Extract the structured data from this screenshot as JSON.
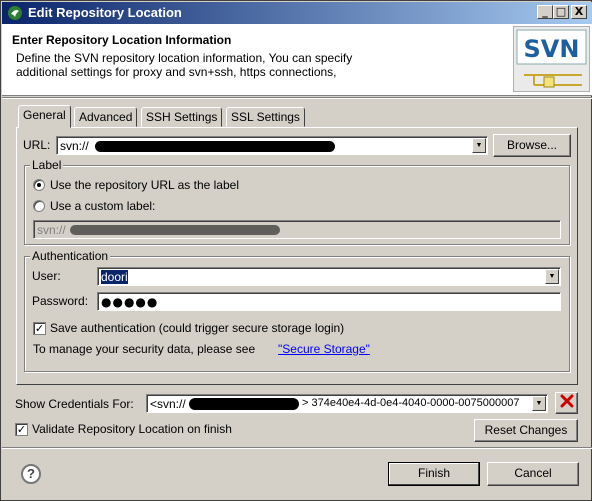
{
  "window": {
    "title": "Edit Repository Location",
    "minimize": "_",
    "maximize": "□",
    "close": "X"
  },
  "header": {
    "title": "Enter Repository Location Information",
    "description_line1": "Define the SVN repository location information, You can specify",
    "description_line2": "additional settings for proxy and svn+ssh, https connections,",
    "logo_text": "SVN"
  },
  "tabs": [
    "General",
    "Advanced",
    "SSH Settings",
    "SSL Settings"
  ],
  "url": {
    "label": "URL:",
    "value": "svn://",
    "browse_label": "Browse..."
  },
  "label_group": {
    "title": "Label",
    "option_url": "Use the repository URL as the label",
    "option_custom": "Use a custom label:",
    "custom_value": "svn://"
  },
  "auth": {
    "title": "Authentication",
    "user_label": "User:",
    "user_value": "doori",
    "password_label": "Password:",
    "password_value": "●●●●●",
    "save_label": "Save authentication (could trigger secure storage login)",
    "manage_text": "To manage your security data, please see",
    "secure_storage_link": "\"Secure Storage\""
  },
  "credentials": {
    "label": "Show Credentials For:",
    "value": "<svn://",
    "value_tail": "> 374e40e4-4d-0e4-4040-0000-0075000007"
  },
  "validate": {
    "label": "Validate Repository Location on finish",
    "reset_label": "Reset Changes"
  },
  "footer": {
    "help": "?",
    "finish_label": "Finish",
    "cancel_label": "Cancel"
  }
}
